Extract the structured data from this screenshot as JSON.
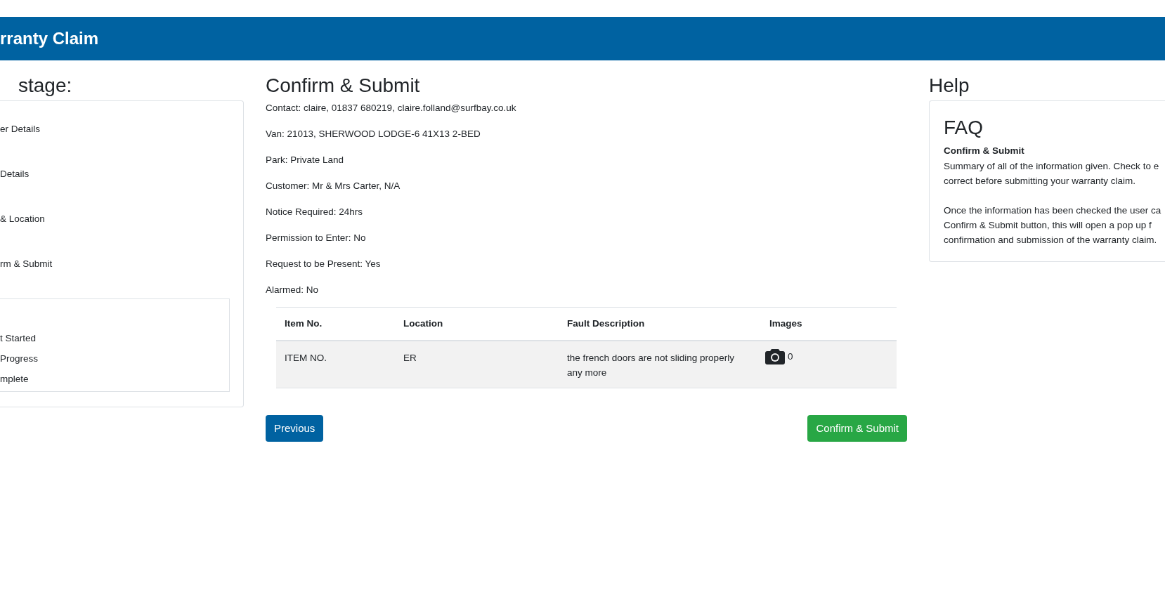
{
  "header": {
    "title": "rranty Claim"
  },
  "stages": {
    "heading": "stage:",
    "items": [
      {
        "label": "er Details"
      },
      {
        "label": "Details"
      },
      {
        "label": "& Location"
      },
      {
        "label": "rm & Submit"
      }
    ],
    "legend": [
      {
        "label": "t Started"
      },
      {
        "label": "Progress"
      },
      {
        "label": "mplete"
      }
    ]
  },
  "summary": {
    "heading": "Confirm & Submit",
    "lines": [
      "Contact: claire, 01837 680219, claire.folland@surfbay.co.uk",
      "Van: 21013, SHERWOOD LODGE-6 41X13 2-BED",
      "Park: Private Land",
      "Customer: Mr & Mrs Carter, N/A",
      "Notice Required: 24hrs",
      "Permission to Enter: No",
      "Request to be Present: Yes",
      "Alarmed: No"
    ],
    "table": {
      "columns": [
        "Item No.",
        "Location",
        "Fault Description",
        "Images"
      ],
      "rows": [
        {
          "item_no": "ITEM NO.",
          "location": "ER",
          "fault_description": "the french doors are not sliding properly any more",
          "images": "0"
        }
      ]
    },
    "buttons": [
      {
        "label": "Previous",
        "kind": "secondary"
      },
      {
        "label": "Confirm & Submit",
        "kind": "primary"
      }
    ]
  },
  "help": {
    "heading": "Help",
    "card_title": "FAQ",
    "subtitle": "Confirm & Submit",
    "paragraphs": [
      [
        "Summary of all of the information given. Check to e",
        "correct before submitting your warranty claim."
      ],
      [
        "Once the information has been checked the user ca",
        "Confirm & Submit button, this will open a pop up f",
        "confirmation and submission of the warranty claim."
      ]
    ]
  }
}
